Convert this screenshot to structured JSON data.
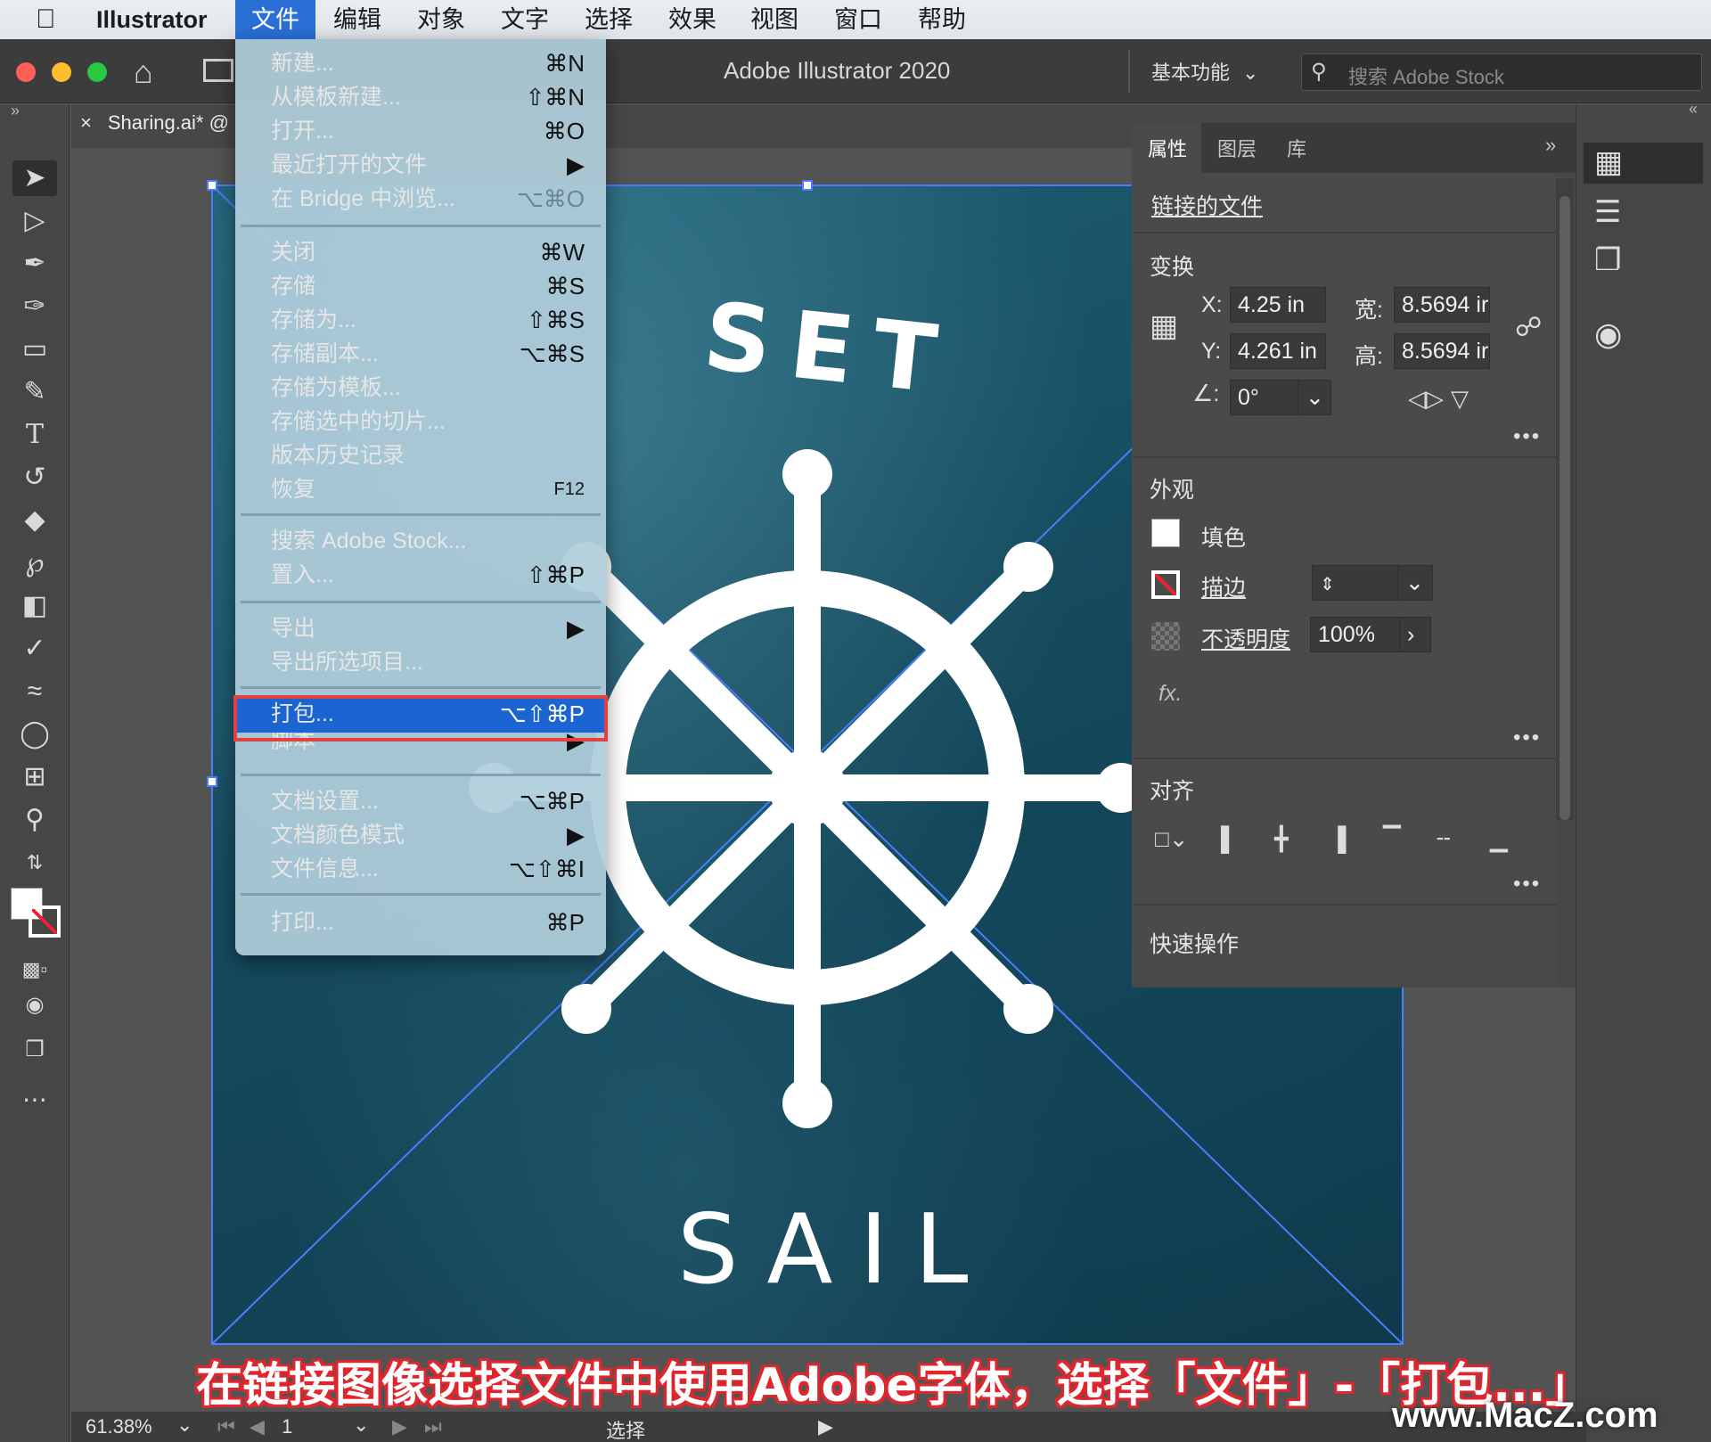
{
  "menubar": {
    "apple": "",
    "app": "Illustrator",
    "items": [
      "文件",
      "编辑",
      "对象",
      "文字",
      "选择",
      "效果",
      "视图",
      "窗口",
      "帮助"
    ]
  },
  "titlebar": {
    "title": "Adobe Illustrator 2020",
    "workspace": "基本功能",
    "search_placeholder": "搜索 Adobe Stock"
  },
  "document": {
    "tab_label": "Sharing.ai* @",
    "art_words": [
      "SET",
      "SAIL"
    ]
  },
  "file_menu": {
    "items": [
      {
        "label": "新建...",
        "shortcut": "⌘N"
      },
      {
        "label": "从模板新建...",
        "shortcut": "⇧⌘N"
      },
      {
        "label": "打开...",
        "shortcut": "⌘O"
      },
      {
        "label": "最近打开的文件",
        "shortcut": "▶"
      },
      {
        "label": "在 Bridge 中浏览...",
        "shortcut": "⌥⌘O"
      },
      {
        "label": "关闭",
        "shortcut": "⌘W"
      },
      {
        "label": "存储",
        "shortcut": "⌘S"
      },
      {
        "label": "存储为...",
        "shortcut": "⇧⌘S"
      },
      {
        "label": "存储副本...",
        "shortcut": "⌥⌘S"
      },
      {
        "label": "存储为模板...",
        "shortcut": ""
      },
      {
        "label": "存储选中的切片...",
        "shortcut": ""
      },
      {
        "label": "版本历史记录",
        "shortcut": ""
      },
      {
        "label": "恢复",
        "shortcut": "F12"
      },
      {
        "label": "搜索 Adobe Stock...",
        "shortcut": ""
      },
      {
        "label": "置入...",
        "shortcut": "⇧⌘P"
      },
      {
        "label": "导出",
        "shortcut": "▶"
      },
      {
        "label": "导出所选项目...",
        "shortcut": ""
      },
      {
        "label": "打包...",
        "shortcut": "⌥⇧⌘P"
      },
      {
        "label": "脚本",
        "shortcut": "▶"
      },
      {
        "label": "文档设置...",
        "shortcut": "⌥⌘P"
      },
      {
        "label": "文档颜色模式",
        "shortcut": "▶"
      },
      {
        "label": "文件信息...",
        "shortcut": "⌥⇧⌘I"
      },
      {
        "label": "打印...",
        "shortcut": "⌘P"
      }
    ]
  },
  "panel": {
    "tabs": [
      "属性",
      "图层",
      "库"
    ],
    "linked_file": "链接的文件",
    "transform": {
      "title": "变换",
      "x_label": "X:",
      "x": "4.25 in",
      "y_label": "Y:",
      "y": "4.261 in",
      "w_label": "宽:",
      "w": "8.5694 ir",
      "h_label": "高:",
      "h": "8.5694 ir",
      "angle": "0°"
    },
    "appearance": {
      "title": "外观",
      "fill": "填色",
      "stroke": "描边",
      "opacity_label": "不透明度",
      "opacity": "100%",
      "fx": "fx."
    },
    "align_title": "对齐",
    "quick_actions": "快速操作"
  },
  "statusbar": {
    "zoom": "61.38%",
    "artboard": "1",
    "tool": "选择"
  },
  "caption": "在链接图像选择文件中使用Adobe字体，选择「文件」-「打包...」",
  "watermark": "www.MacZ.com",
  "colors": {
    "highlight_blue": "#1b64d1",
    "highlight_border": "#e34141",
    "caption_outline": "#e0262d"
  }
}
